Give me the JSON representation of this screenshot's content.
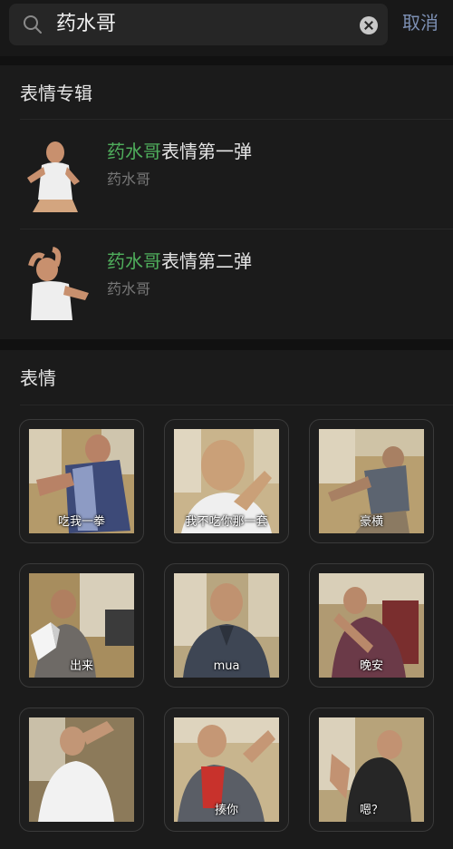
{
  "search": {
    "query": "药水哥",
    "cancel_label": "取消"
  },
  "albums": {
    "heading": "表情专辑",
    "items": [
      {
        "highlight": "药水哥",
        "rest": "表情第一弹",
        "author": "药水哥"
      },
      {
        "highlight": "药水哥",
        "rest": "表情第二弹",
        "author": "药水哥"
      }
    ]
  },
  "stickers": {
    "heading": "表情",
    "items": [
      {
        "caption": "吃我一拳"
      },
      {
        "caption": "我不吃你那一套"
      },
      {
        "caption": "豪横"
      },
      {
        "caption": "出来"
      },
      {
        "caption": "mua"
      },
      {
        "caption": "晚安"
      },
      {
        "caption": ""
      },
      {
        "caption": "揍你"
      },
      {
        "caption": "嗯？"
      }
    ]
  },
  "colors": {
    "background": "#111111",
    "highlight": "#4fae5c",
    "link": "#7d90b4"
  }
}
